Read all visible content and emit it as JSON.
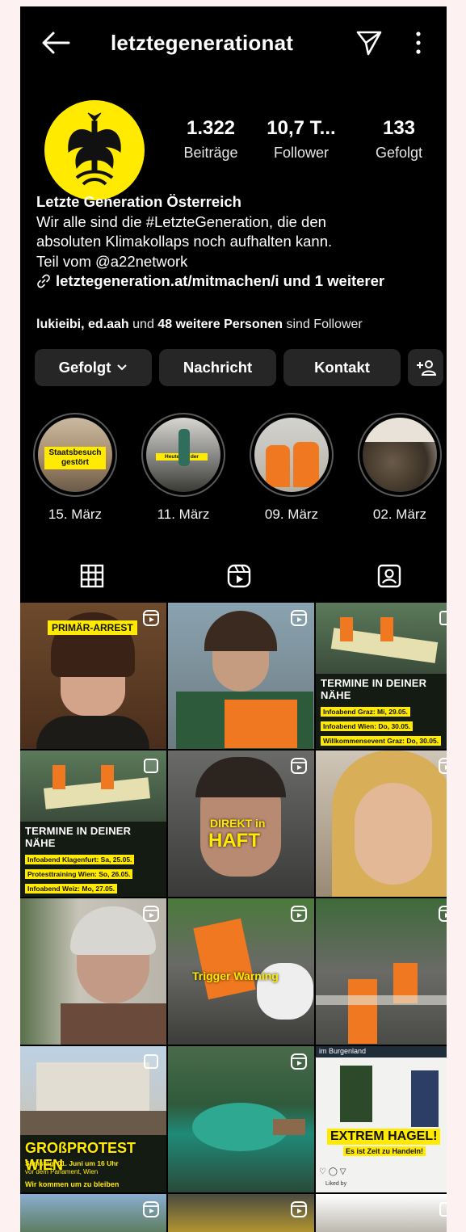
{
  "header": {
    "username": "letztegenerationat"
  },
  "stats": [
    {
      "value": "1.322",
      "label": "Beiträge"
    },
    {
      "value": "10,7 T...",
      "label": "Follower"
    },
    {
      "value": "133",
      "label": "Gefolgt"
    }
  ],
  "bio": {
    "name": "Letzte Generation Österreich",
    "line1": "Wir alle sind die #LetzteGeneration, die den",
    "line2": "absoluten Klimakollaps noch aufhalten kann.",
    "line3": "Teil vom @a22network",
    "link": "letztegeneration.at/mitmachen/i und 1 weiterer"
  },
  "followers": {
    "names": "lukieibi, ed.aah",
    "mid": " und ",
    "count": "48 weitere Personen",
    "tail": " sind Follower"
  },
  "buttons": {
    "following": "Gefolgt",
    "message": "Nachricht",
    "contact": "Kontakt"
  },
  "highlights": [
    {
      "label": "15. März",
      "tag": "Staatsbesuch gestört"
    },
    {
      "label": "11. März",
      "tag": "Heute vor der"
    },
    {
      "label": "09. März"
    },
    {
      "label": "02. März"
    }
  ],
  "tabs": [
    "grid-icon",
    "reels-icon",
    "tagged-icon"
  ],
  "posts": {
    "p1": {
      "tag": "PRIMÄR-ARREST"
    },
    "p3": {
      "title": "TERMINE IN DEINER NÄHE",
      "lines": [
        "Infoabend Graz: Mi, 29.05.",
        "Infoabend Wien: Do, 30.05.",
        "Willkommensevent Graz: Do, 30.05."
      ]
    },
    "p4": {
      "title": "TERMINE IN DEINER NÄHE",
      "lines": [
        "Infoabend Klagenfurt: Sa, 25.05.",
        "Protesttraining Wien: So, 26.05.",
        "Infoabend Weiz: Mo, 27.05."
      ]
    },
    "p5": {
      "line1": "DIREKT in",
      "line2": "HAFT"
    },
    "p8": {
      "text": "Trigger Warning"
    },
    "p10": {
      "title": "GROßPROTEST WIEN",
      "line1": "Samstag, 01. Juni um 16 Uhr",
      "line2": "vor dem Parlament, Wien",
      "line3": "Wir kommen um zu bleiben"
    },
    "p12": {
      "top": "im Burgenland",
      "title": "EXTREM HAGEL!",
      "sub": "Es ist Zeit zu Handeln!",
      "small": "Liked by"
    }
  }
}
